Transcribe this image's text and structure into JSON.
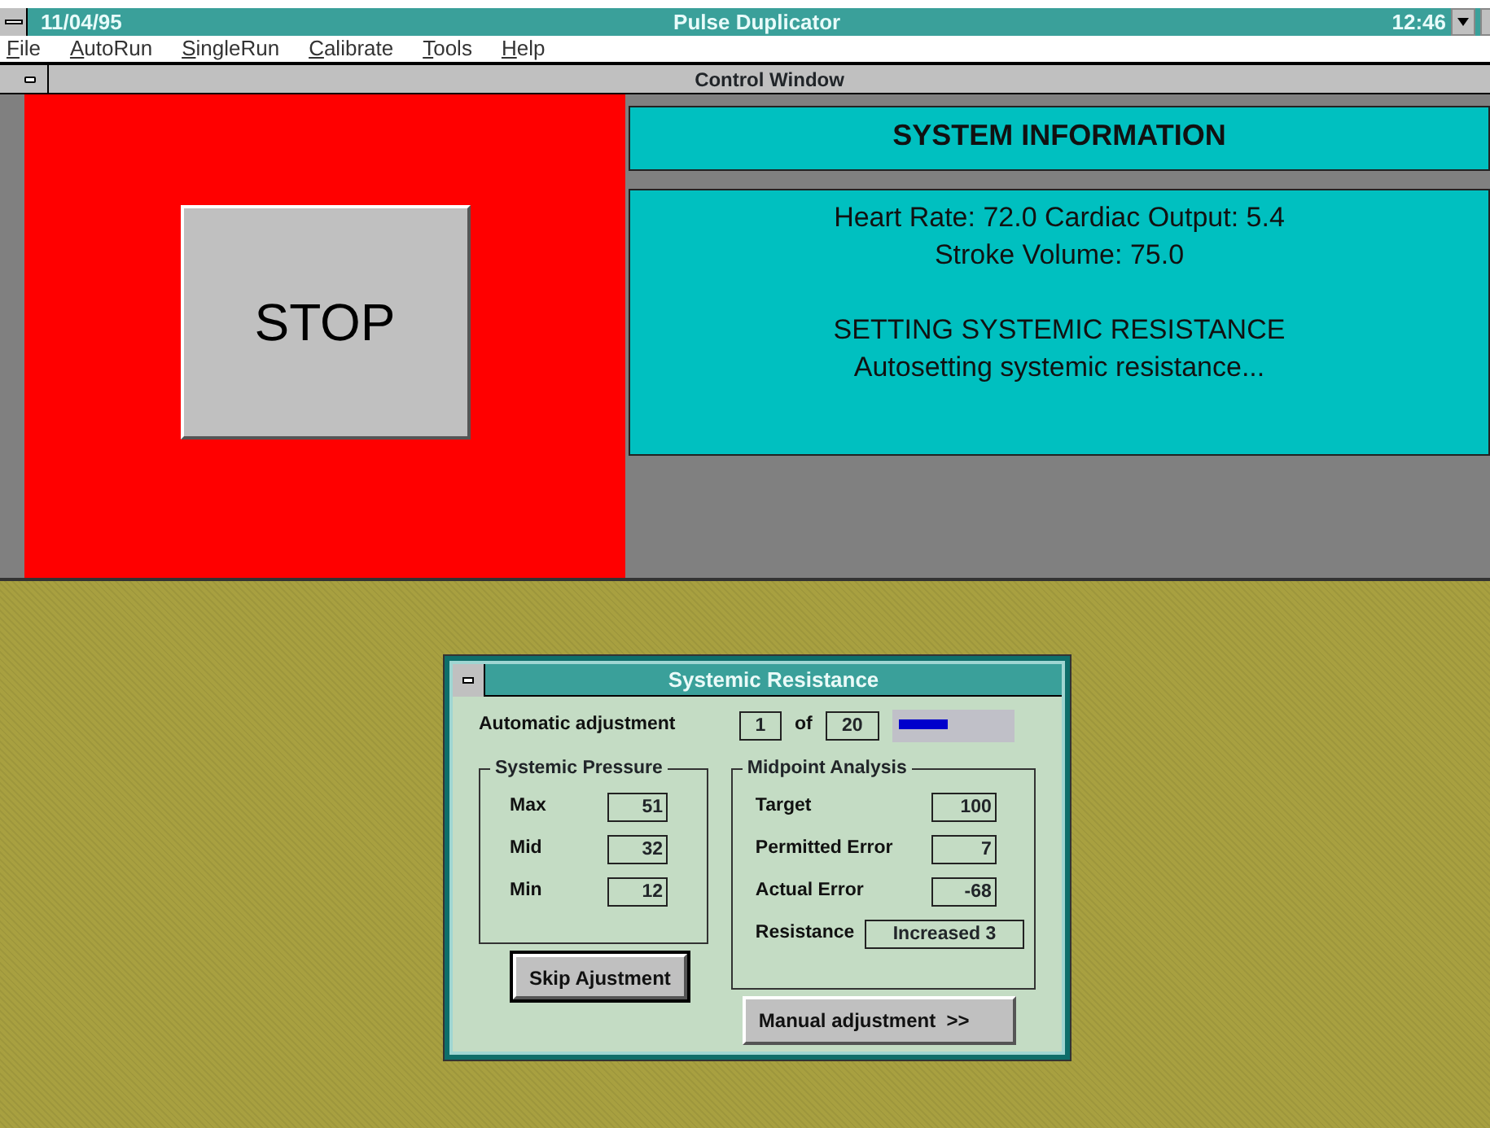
{
  "app_window": {
    "date": "11/04/95",
    "title": "Pulse Duplicator",
    "time": "12:46"
  },
  "menu": [
    "File",
    "AutoRun",
    "SingleRun",
    "Calibrate",
    "Tools",
    "Help"
  ],
  "control_window": {
    "title": "Control Window",
    "stop_button": "STOP",
    "info_heading": "SYSTEM INFORMATION",
    "info_blocks": [
      [
        "Heart Rate: 72.0 Cardiac Output: 5.4",
        "Stroke Volume: 75.0"
      ],
      [
        "SETTING SYSTEMIC RESISTANCE",
        "Autosetting systemic resistance..."
      ]
    ]
  },
  "dialog": {
    "title": "Systemic Resistance",
    "auto_label": "Automatic adjustment",
    "step": "1",
    "of_label": "of",
    "total": "20",
    "progress": {
      "level": 0.45
    },
    "pressure_group": {
      "title": "Systemic Pressure",
      "rows": [
        {
          "label": "Max",
          "value": "51"
        },
        {
          "label": "Mid",
          "value": "32"
        },
        {
          "label": "Min",
          "value": "12"
        }
      ]
    },
    "midpoint_group": {
      "title": "Midpoint Analysis",
      "rows": [
        {
          "label": "Target",
          "value": "100"
        },
        {
          "label": "Permitted Error",
          "value": "7"
        },
        {
          "label": "Actual Error",
          "value": "-68"
        }
      ],
      "resistance_label": "Resistance",
      "resistance_value": "Increased 3"
    },
    "buttons": [
      {
        "label": "Skip Ajustment",
        "default": true
      },
      {
        "label": "Manual adjustment  >>",
        "default": false
      }
    ]
  }
}
